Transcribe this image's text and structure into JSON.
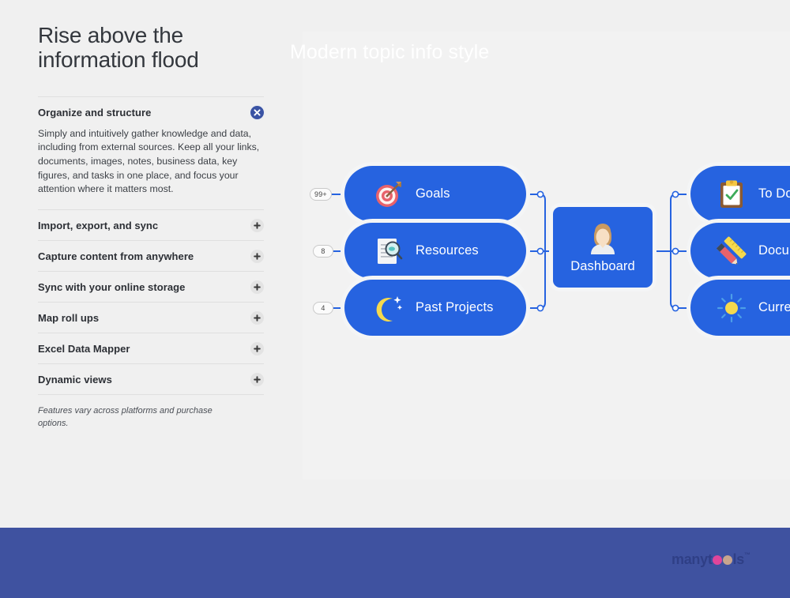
{
  "headline": {
    "line1": "Rise above the",
    "line2": "information flood"
  },
  "accordion": {
    "expanded": {
      "title": "Organize and structure",
      "body": "Simply and intuitively gather knowledge and data, including from external sources. Keep all your links, documents, images, notes, business data, key figures, and tasks in one place, and focus your attention where it matters most.",
      "toggle_icon": "close-circle-icon"
    },
    "collapsed": [
      {
        "title": "Import, export, and sync",
        "toggle_icon": "plus-circle-icon"
      },
      {
        "title": "Capture content from anywhere",
        "toggle_icon": "plus-circle-icon"
      },
      {
        "title": "Sync with your online storage",
        "toggle_icon": "plus-circle-icon"
      },
      {
        "title": "Map roll ups",
        "toggle_icon": "plus-circle-icon"
      },
      {
        "title": "Excel Data Mapper",
        "toggle_icon": "plus-circle-icon"
      },
      {
        "title": "Dynamic views",
        "toggle_icon": "plus-circle-icon"
      }
    ]
  },
  "footnote": "Features vary across platforms and purchase options.",
  "mindmap": {
    "center": {
      "label": "Dashboard",
      "icon": "person-avatar-icon"
    },
    "left_nodes": [
      {
        "label": "Goals",
        "icon": "target-arrow-icon",
        "badge": "99+"
      },
      {
        "label": "Resources",
        "icon": "document-magnifier-icon",
        "badge": "8"
      },
      {
        "label": "Past Projects",
        "icon": "crescent-moon-icon",
        "badge": "4"
      }
    ],
    "right_nodes": [
      {
        "label": "To Do",
        "icon": "clipboard-check-icon"
      },
      {
        "label": "Documents",
        "icon": "ruler-pencil-icon"
      },
      {
        "label": "Current",
        "icon": "sun-icon"
      }
    ],
    "colors": {
      "node": "#2663e0",
      "wire": "#2663e0",
      "canvas": "#f2f2f2"
    }
  },
  "footer": {
    "title": "Modern topic info style",
    "background": "#3f52a0",
    "brand": {
      "part1": "manyt",
      "part2": "ls",
      "trademark": "™",
      "dot_a_color": "#e0459b",
      "dot_b_color": "#c7a58e"
    }
  }
}
